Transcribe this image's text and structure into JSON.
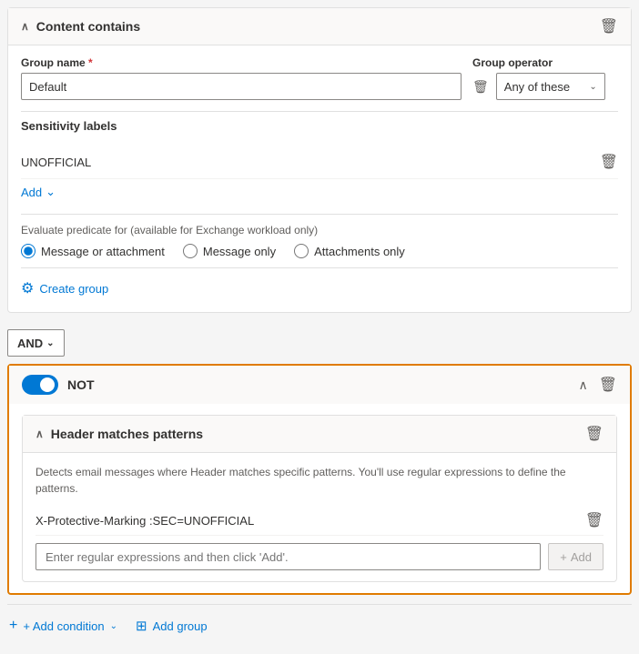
{
  "contentContains": {
    "title": "Content contains",
    "deleteLabel": "delete",
    "groupName": {
      "label": "Group name",
      "required": true,
      "value": "Default",
      "placeholder": "Default"
    },
    "groupOperator": {
      "label": "Group operator",
      "value": "Any of these",
      "chevron": "∨"
    },
    "sensitivityLabels": {
      "sectionLabel": "Sensitivity labels",
      "items": [
        {
          "name": "UNOFFICIAL"
        }
      ]
    },
    "addButton": "Add",
    "evaluatePredicate": {
      "label": "Evaluate predicate for (available for Exchange workload only)",
      "options": [
        {
          "id": "msg-attachment",
          "label": "Message or attachment",
          "checked": true
        },
        {
          "id": "msg-only",
          "label": "Message only",
          "checked": false
        },
        {
          "id": "attach-only",
          "label": "Attachments only",
          "checked": false
        }
      ]
    },
    "createGroup": "Create group"
  },
  "andDropdown": {
    "label": "AND",
    "chevron": "∨"
  },
  "notSection": {
    "toggleOn": true,
    "label": "NOT",
    "chevronUp": "∧",
    "deleteLabel": "delete",
    "headerMatchesPatterns": {
      "title": "Header matches patterns",
      "deleteLabel": "delete",
      "chevron": "∧",
      "description": "Detects email messages where Header matches specific patterns. You'll use regular expressions to define the patterns.",
      "patterns": [
        {
          "text": "X-Protective-Marking :SEC=UNOFFICIAL"
        }
      ],
      "regexInput": {
        "placeholder": "Enter regular expressions and then click 'Add'."
      },
      "addButton": "+ Add"
    }
  },
  "bottomBar": {
    "addCondition": "+ Add condition",
    "addGroup": "Add group",
    "chevron": "∨"
  },
  "icons": {
    "chevronDown": "⌄",
    "chevronUp": "∧",
    "trash": "🗑",
    "plus": "+",
    "createGroup": "⚙",
    "addGroup": "⊞"
  }
}
